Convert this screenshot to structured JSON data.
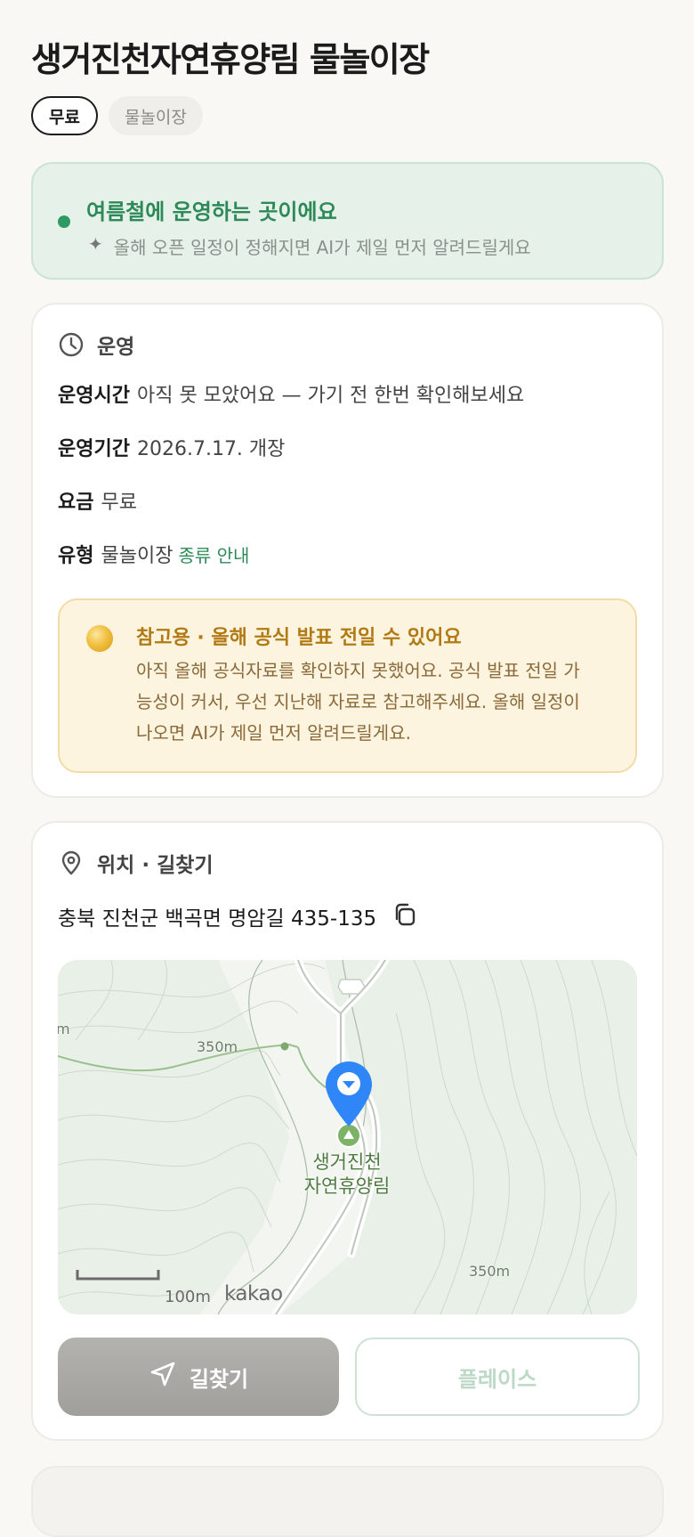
{
  "page": {
    "title": "생거진천자연휴양림 물놀이장"
  },
  "tags": {
    "price": "무료",
    "type": "물놀이장"
  },
  "season_notice": {
    "title": "여름철에 운영하는 곳이에요",
    "sparkle": "✦",
    "subtitle": "올해 오픈 일정이 정해지면 AI가 제일 먼저 알려드릴게요"
  },
  "operation": {
    "heading": "운영",
    "rows": [
      {
        "key": "운영시간",
        "value": "아직 못 모았어요 — 가기 전 한번 확인해보세요"
      },
      {
        "key": "운영기간",
        "value": "2026.7.17. 개장"
      },
      {
        "key": "요금",
        "value": "무료"
      },
      {
        "key": "유형",
        "value": "물놀이장",
        "link": "종류 안내"
      }
    ],
    "notice": {
      "title": "참고용 · 올해 공식 발표 전일 수 있어요",
      "body": "아직 올해 공식자료를 확인하지 못했어요. 공식 발표 전일 가능성이 커서, 우선 지난해 자료로 참고해주세요. 올해 일정이 나오면 AI가 제일 먼저 알려드릴게요."
    }
  },
  "location": {
    "heading": "위치 · 길찾기",
    "address": "충북 진천군 백곡면 명암길 435-135",
    "map": {
      "place_label": "생거진천\n자연휴양림",
      "elev_top": "350m",
      "elev_bottom": "350m",
      "edge_text": "m",
      "scale": "100m",
      "brand": "kakao"
    },
    "buttons": {
      "navigate": "길찾기",
      "place": "플레이스"
    }
  },
  "colors": {
    "accent_green": "#2d8a58",
    "notice_amber": "#b27a14",
    "pin_blue": "#2f86f6"
  },
  "icons": {
    "operation": "clock-icon",
    "location": "map-pin-icon",
    "copy": "copy-icon",
    "navigate": "navigation-arrow-icon"
  }
}
